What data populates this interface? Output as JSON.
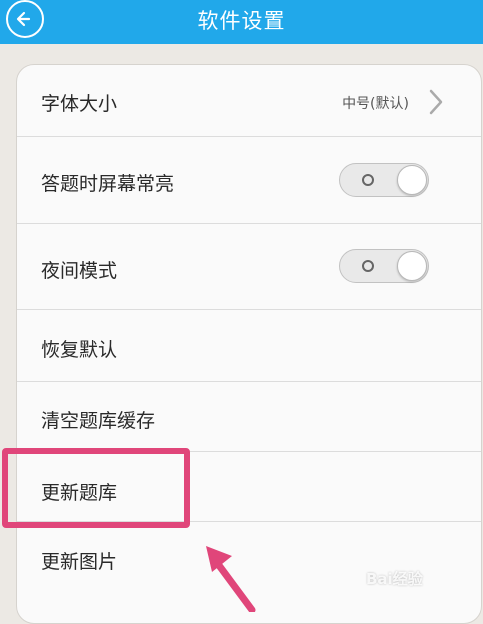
{
  "header": {
    "title": "软件设置",
    "back_icon": "back-arrow-icon",
    "bg_color": "#21a8ea"
  },
  "settings": {
    "font_size": {
      "label": "字体大小",
      "value": "中号(默认)"
    },
    "screen_on": {
      "label": "答题时屏幕常亮"
    },
    "night_mode": {
      "label": "夜间模式"
    },
    "restore_default": {
      "label": "恢复默认"
    },
    "clear_cache": {
      "label": "清空题库缓存"
    },
    "update_bank": {
      "label": "更新题库"
    },
    "update_images": {
      "label": "更新图片"
    }
  },
  "annotation": {
    "highlight_color": "#e0467a"
  },
  "watermark": {
    "text": "Bai经验"
  }
}
